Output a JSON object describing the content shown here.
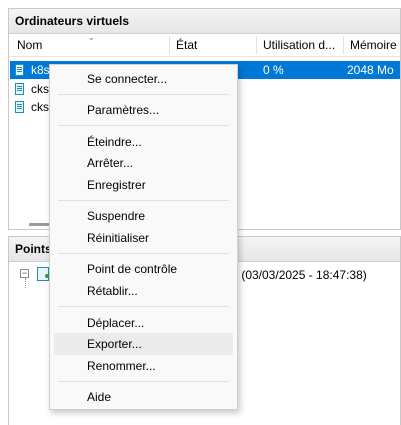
{
  "vm_panel": {
    "title": "Ordinateurs virtuels",
    "columns": [
      "Nom",
      "État",
      "Utilisation d...",
      "Mémoire"
    ],
    "rows": [
      {
        "name": "k8s",
        "state": "",
        "cpu": "0 %",
        "memory": "2048 Mo",
        "selected": true
      },
      {
        "name": "cks",
        "state": "",
        "cpu": "",
        "memory": "",
        "selected": false
      },
      {
        "name": "cks",
        "state": "",
        "cpu": "",
        "memory": "",
        "selected": false
      }
    ]
  },
  "checkpoints_panel": {
    "title": "Points",
    "checkpoint_suffix": "- (03/03/2025 - 18:47:38)"
  },
  "context_menu": {
    "items": [
      {
        "id": "connect",
        "label": "Se connecter..."
      },
      {
        "id": "settings",
        "label": "Paramètres..."
      },
      {
        "id": "turn-off",
        "label": "Éteindre..."
      },
      {
        "id": "shut-down",
        "label": "Arrêter..."
      },
      {
        "id": "save",
        "label": "Enregistrer"
      },
      {
        "id": "pause",
        "label": "Suspendre"
      },
      {
        "id": "reset",
        "label": "Réinitialiser"
      },
      {
        "id": "checkpoint",
        "label": "Point de contrôle"
      },
      {
        "id": "revert",
        "label": "Rétablir..."
      },
      {
        "id": "move",
        "label": "Déplacer..."
      },
      {
        "id": "export",
        "label": "Exporter..."
      },
      {
        "id": "rename",
        "label": "Renommer..."
      },
      {
        "id": "help",
        "label": "Aide"
      }
    ],
    "hovered": "export"
  },
  "colors": {
    "selection": "#0078d7",
    "menu_background": "#f9f9f9",
    "menu_hover": "#ebebeb"
  }
}
